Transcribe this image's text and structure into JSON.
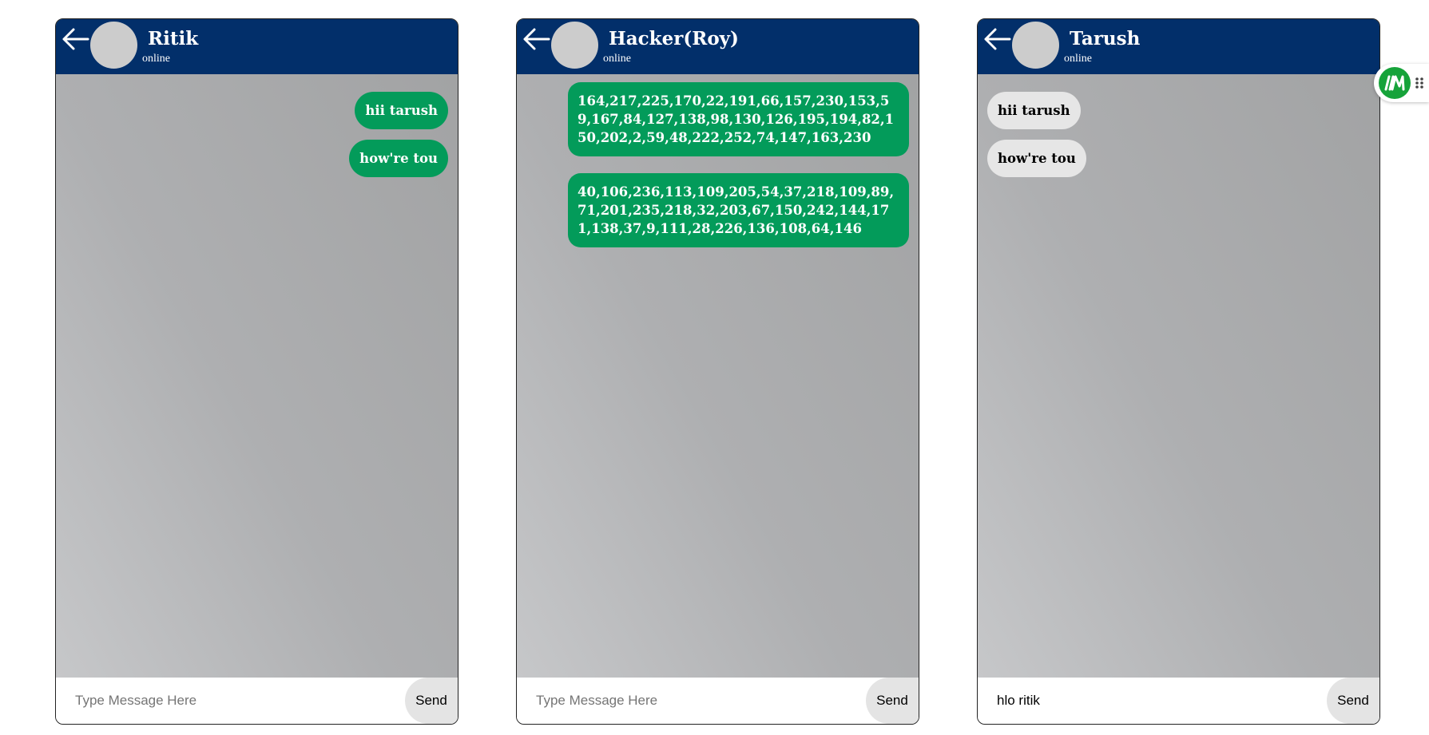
{
  "chats": [
    {
      "contact_name": "Ritik",
      "status": "online",
      "messages": [
        {
          "text": "hii tarush",
          "direction": "sent"
        },
        {
          "text": "how're tou",
          "direction": "sent"
        }
      ],
      "input_value": "",
      "input_placeholder": "Type Message Here",
      "send_label": "Send"
    },
    {
      "contact_name": "Hacker(Roy)",
      "status": "online",
      "messages": [
        {
          "text": "164,217,225,170,22,191,66,157,230,153,59,167,84,127,138,98,130,126,195,194,82,150,202,2,59,48,222,252,74,147,163,230",
          "direction": "sent"
        },
        {
          "text": "40,106,236,113,109,205,54,37,218,109,89,71,201,235,218,32,203,67,150,242,144,171,138,37,9,111,28,226,136,108,64,146",
          "direction": "sent"
        }
      ],
      "input_value": "",
      "input_placeholder": "Type Message Here",
      "send_label": "Send"
    },
    {
      "contact_name": "Tarush",
      "status": "online",
      "messages": [
        {
          "text": "hii tarush",
          "direction": "received"
        },
        {
          "text": "how're tou",
          "direction": "received"
        }
      ],
      "input_value": "hlo ritik",
      "input_placeholder": "Type Message Here",
      "send_label": "Send"
    }
  ],
  "colors": {
    "header": "#022f6a",
    "sent_bubble": "#039b5a",
    "received_bubble": "#e6e6e6",
    "extension_logo": "#16a33a"
  },
  "icons": {
    "back": "back-arrow-icon",
    "extension": "extension-logo-icon",
    "grip": "drag-grip-icon"
  }
}
